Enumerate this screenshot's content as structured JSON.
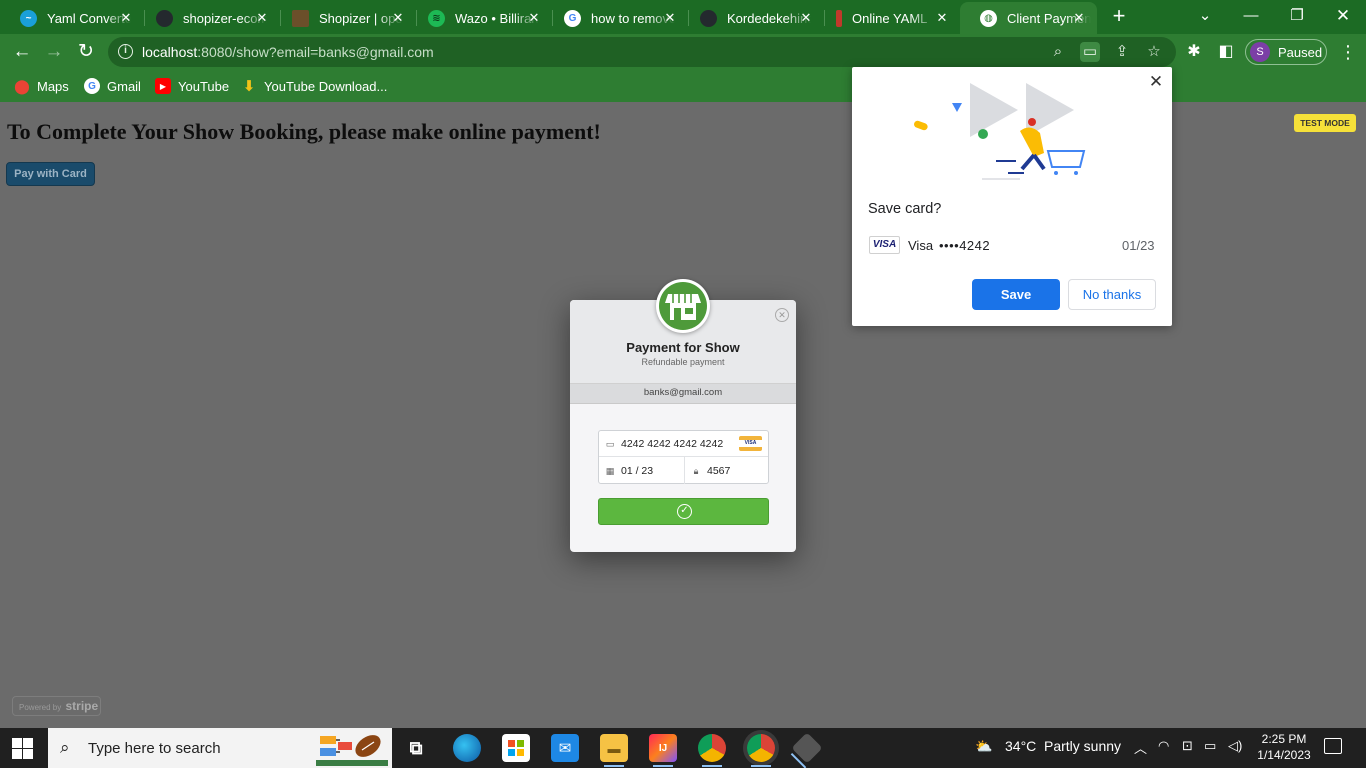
{
  "browser": {
    "tabs": [
      {
        "title": "Yaml Converter",
        "icon": "yaml-converter-icon",
        "color": "#1aa0d8"
      },
      {
        "title": "shopizer-ecommerce",
        "icon": "github-icon",
        "color": "#24292e"
      },
      {
        "title": "Shopizer | open source",
        "icon": "shopizer-icon",
        "color": "#6b4f2a"
      },
      {
        "title": "Wazo • Billiran",
        "icon": "spotify-icon",
        "color": "#1db954"
      },
      {
        "title": "how to remove",
        "icon": "google-icon",
        "color": "#ffffff"
      },
      {
        "title": "Kordedekehinde",
        "icon": "github-icon",
        "color": "#24292e"
      },
      {
        "title": "Online YAML",
        "icon": "online-yaml-icon",
        "color": "#c0392b"
      },
      {
        "title": "Client Payment",
        "icon": "globe-icon",
        "color": "#ffffff",
        "active": true
      }
    ],
    "url_host": "localhost",
    "url_rest": ":8080/show?email=banks@gmail.com",
    "profile_initial": "S",
    "profile_status": "Paused",
    "bookmarks": [
      {
        "label": "Maps",
        "icon": "maps-icon"
      },
      {
        "label": "Gmail",
        "icon": "gmail-icon"
      },
      {
        "label": "YouTube",
        "icon": "youtube-icon"
      },
      {
        "label": "YouTube Download...",
        "icon": "download-icon"
      }
    ]
  },
  "page": {
    "heading": "To Complete Your Show Booking, please make online payment!",
    "pay_button": "Pay with Card",
    "test_mode": "TEST MODE",
    "powered_by": "Powered by",
    "powered_brand": "stripe"
  },
  "checkout": {
    "title": "Payment for Show",
    "subtitle": "Refundable payment",
    "email": "banks@gmail.com",
    "card_number": "4242 4242 4242 4242",
    "expiry": "01 / 23",
    "cvc": "4567",
    "card_brand": "VISA"
  },
  "save_card": {
    "title": "Save card?",
    "network_badge": "VISA",
    "network": "Visa",
    "number": "••••4242",
    "expiry": "01/23",
    "save_label": "Save",
    "no_thanks_label": "No thanks"
  },
  "taskbar": {
    "search_placeholder": "Type here to search",
    "temperature": "34°C",
    "weather": "Partly sunny",
    "time": "2:25 PM",
    "date": "1/14/2023"
  },
  "colors": {
    "chrome_green": "#2e7d32",
    "stripe_green": "#5cb73f",
    "google_blue": "#1a73e8",
    "test_mode_yellow": "#f6e139"
  }
}
